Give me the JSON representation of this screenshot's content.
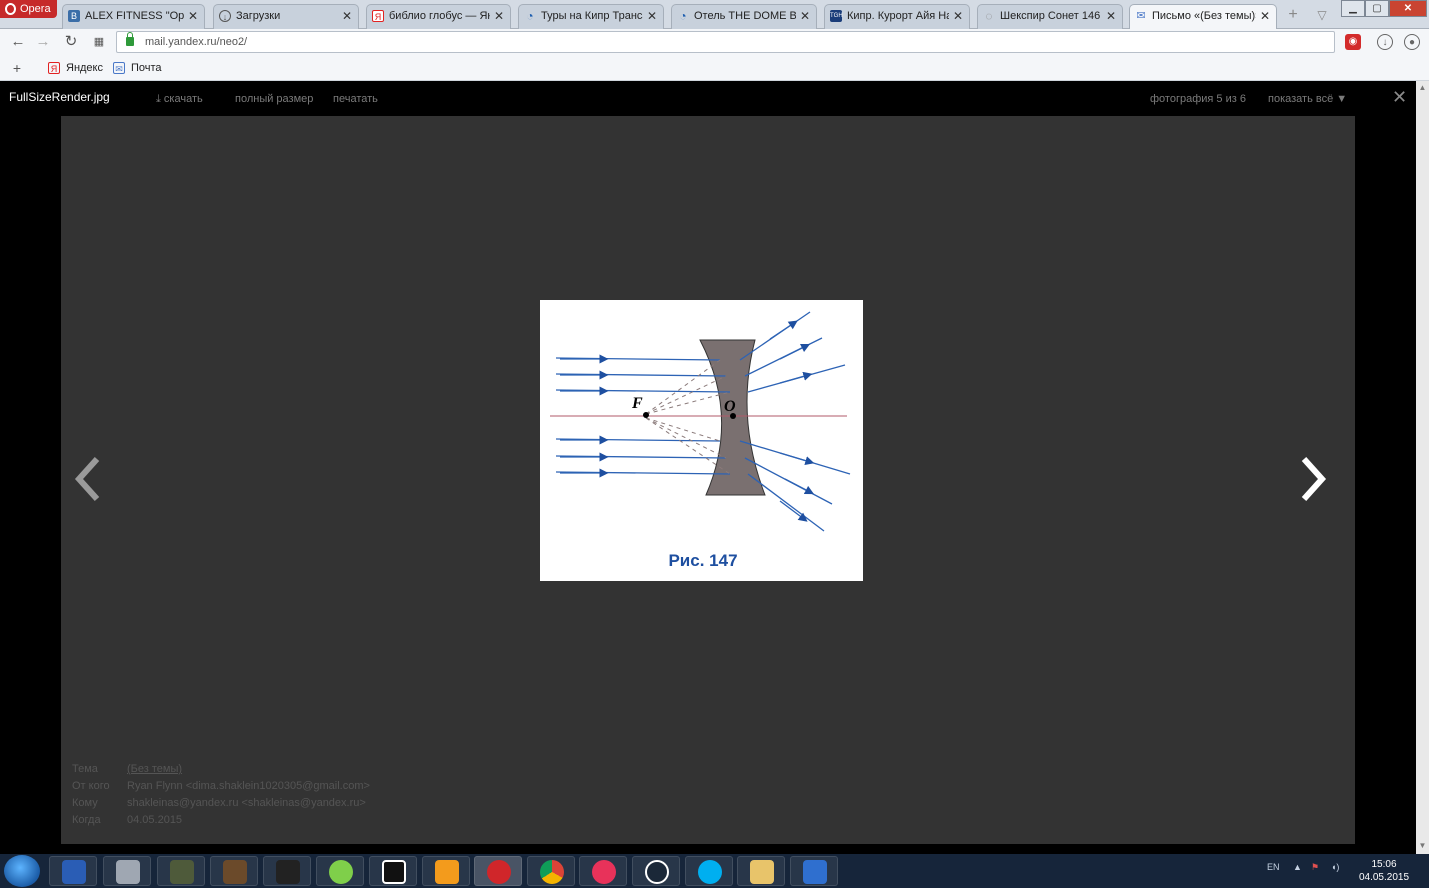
{
  "browser": {
    "menu_label": "Opera",
    "tabs": [
      {
        "title": "ALEX FITNESS \"Оранж",
        "icon": "B",
        "icon_color": "#3b6ea8"
      },
      {
        "title": "Загрузки",
        "icon": "↓",
        "icon_color": "#666666"
      },
      {
        "title": "библио глобус — Янд",
        "icon": "Я",
        "icon_color": "#e22222"
      },
      {
        "title": "Туры на Кипр Трансаз",
        "icon": "◔",
        "icon_color": "#1f5fb0"
      },
      {
        "title": "Отель THE DOME BEAC",
        "icon": "◔",
        "icon_color": "#1f5fb0"
      },
      {
        "title": "Кипр. Курорт Айя Напа",
        "icon": "TGH",
        "icon_color": "#1a3d7a"
      },
      {
        "title": "Шекспир Сонет 146",
        "icon": "◌",
        "icon_color": "#888888"
      },
      {
        "title": "Письмо «(Без темы)» —",
        "icon": "✉",
        "icon_color": "#4a78c8"
      }
    ],
    "url": "mail.yandex.ru/neo2/",
    "bookmarks": [
      {
        "label": "Яндекс",
        "icon": "Я"
      },
      {
        "label": "Почта",
        "icon": "✉"
      }
    ]
  },
  "viewer": {
    "filename": "FullSizeRender.jpg",
    "download_label": "скачать",
    "fullsize_label": "полный размер",
    "print_label": "печатать",
    "counter": "фотография 5 из 6",
    "show_all_label": "показать всё ▼",
    "image": {
      "label_f": "F",
      "label_o": "O",
      "caption": "Рис. 147"
    },
    "meta": [
      {
        "key": "Тема",
        "value": "(Без темы)"
      },
      {
        "key": "От кого",
        "value": "Ryan Flynn <dima.shaklein1020305@gmail.com>"
      },
      {
        "key": "Кому",
        "value": "shakleinas@yandex.ru <shakleinas@yandex.ru>"
      },
      {
        "key": "Когда",
        "value": "04.05.2015"
      }
    ]
  },
  "taskbar": {
    "lang": "EN",
    "time": "15:06",
    "date": "04.05.2015"
  }
}
